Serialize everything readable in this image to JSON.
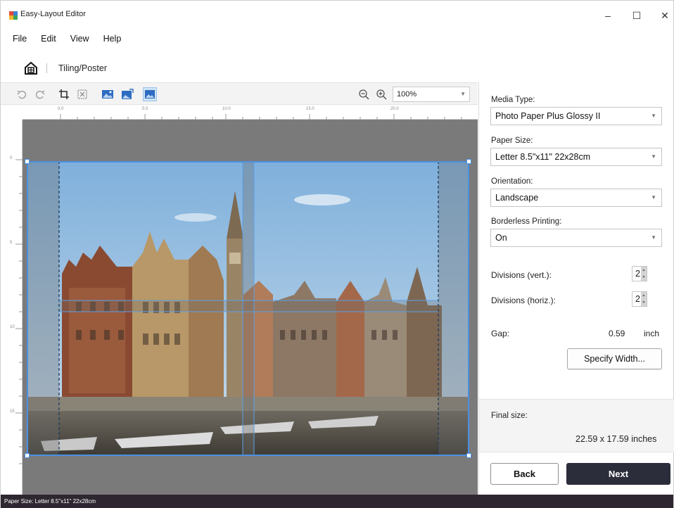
{
  "window": {
    "title": "Easy-Layout Editor",
    "controls": {
      "minimize": "–",
      "maximize": "☐",
      "close": "✕"
    }
  },
  "menu": [
    "File",
    "Edit",
    "View",
    "Help"
  ],
  "breadcrumb": {
    "current": "Tiling/Poster"
  },
  "toolbar": {
    "icons": [
      "undo-icon",
      "redo-icon",
      "crop-icon",
      "fit-icon",
      "image-icon",
      "image-rotate-icon",
      "image-tile-icon",
      "zoom-out-icon",
      "zoom-in-icon"
    ],
    "zoom_value": "100%"
  },
  "ruler": {
    "top_labels": [
      "0.0",
      "5.0",
      "10.0",
      "15.0",
      "20.0"
    ],
    "left_labels": [
      "0",
      "5",
      "10",
      "15"
    ]
  },
  "panel": {
    "media_type": {
      "label": "Media Type:",
      "value": "Photo Paper Plus Glossy II"
    },
    "paper_size": {
      "label": "Paper Size:",
      "value": "Letter 8.5\"x11\" 22x28cm"
    },
    "orientation": {
      "label": "Orientation:",
      "value": "Landscape"
    },
    "borderless": {
      "label": "Borderless Printing:",
      "value": "On"
    },
    "div_vert": {
      "label": "Divisions (vert.):",
      "value": "2"
    },
    "div_horiz": {
      "label": "Divisions (horiz.):",
      "value": "2"
    },
    "gap": {
      "label": "Gap:",
      "value": "0.59",
      "unit": "inch"
    },
    "specify_width": "Specify Width...",
    "final_size": {
      "label": "Final size:",
      "value": "22.59 x 17.59 inches"
    },
    "back": "Back",
    "next": "Next"
  },
  "status": {
    "text": "Paper Size: Letter 8.5\"x11\" 22x28cm"
  },
  "colors": {
    "accent": "#4a90e2",
    "next_button": "#2b2d3a",
    "status_bar": "#2e2731",
    "canvas": "#7a7a7a"
  }
}
